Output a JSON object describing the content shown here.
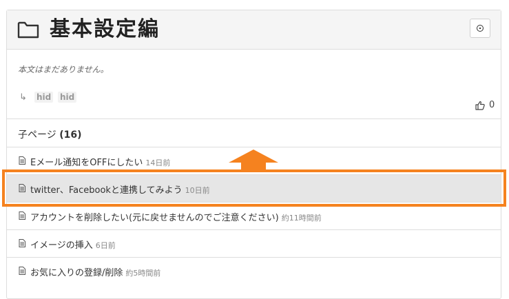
{
  "header": {
    "title": "基本設定編",
    "folder_icon": "folder-icon",
    "watch_icon": "watch-icon"
  },
  "content": {
    "body_text": "本文はまだありません。",
    "tag_arrow": "↳",
    "tags": [
      "hid",
      "hid"
    ],
    "like_icon": "thumbs-up-icon",
    "like_count": "0"
  },
  "children": {
    "heading": "子ページ",
    "count": "(16)",
    "items": [
      {
        "title": "Eメール通知をOFFにしたい",
        "time": "14日前"
      },
      {
        "title": "twitter、Facebookと連携してみよう",
        "time": "10日前"
      },
      {
        "title": "アカウントを削除したい(元に戻せませんのでご注意ください)",
        "time": "約11時間前"
      },
      {
        "title": "イメージの挿入",
        "time": "6日前"
      },
      {
        "title": "お気に入りの登録/削除",
        "time": "約5時間前"
      }
    ]
  },
  "annotation": {
    "highlight_color": "#f5821f",
    "highlighted_index": 1
  }
}
